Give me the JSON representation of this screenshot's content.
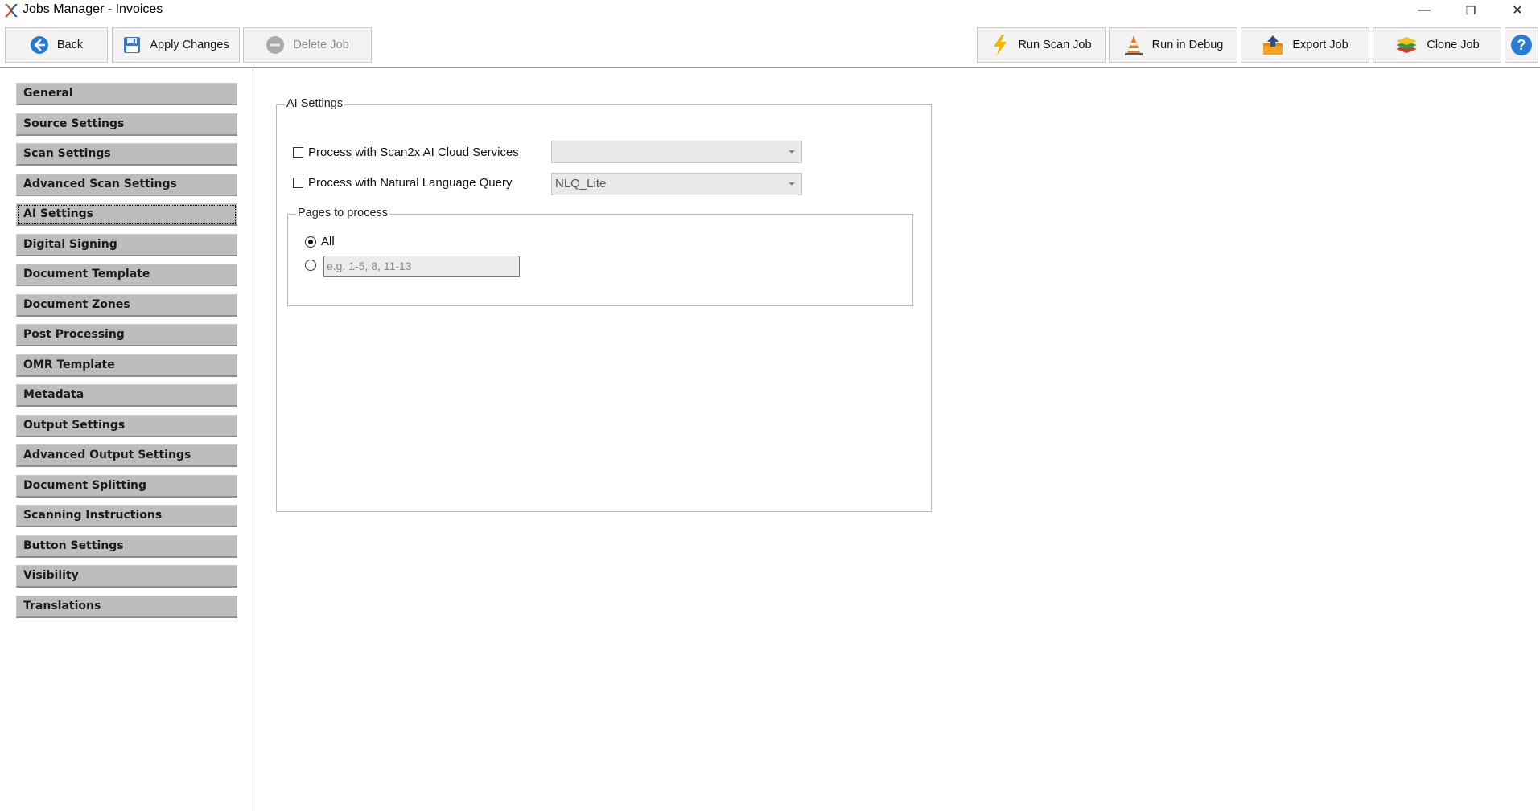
{
  "window": {
    "title": "Jobs Manager - Invoices",
    "controls": {
      "minimize": "—",
      "restore": "❐",
      "close": "✕"
    }
  },
  "toolbar": {
    "back_label": "Back",
    "apply_label": "Apply Changes",
    "delete_label": "Delete Job",
    "run_scan_label": "Run Scan Job",
    "run_debug_label": "Run in Debug",
    "export_label": "Export Job",
    "clone_label": "Clone Job",
    "help_symbol": "?"
  },
  "sidebar": {
    "items": [
      {
        "label": "General"
      },
      {
        "label": "Source Settings"
      },
      {
        "label": "Scan Settings"
      },
      {
        "label": "Advanced Scan Settings"
      },
      {
        "label": "AI Settings",
        "active": true
      },
      {
        "label": "Digital Signing"
      },
      {
        "label": "Document Template"
      },
      {
        "label": "Document Zones"
      },
      {
        "label": "Post Processing"
      },
      {
        "label": "OMR Template"
      },
      {
        "label": "Metadata"
      },
      {
        "label": "Output Settings"
      },
      {
        "label": "Advanced Output Settings"
      },
      {
        "label": "Document Splitting"
      },
      {
        "label": "Scanning Instructions"
      },
      {
        "label": "Button Settings"
      },
      {
        "label": "Visibility"
      },
      {
        "label": "Translations"
      }
    ]
  },
  "ai_settings": {
    "group_title": "AI Settings",
    "cloud_services": {
      "label": "Process with Scan2x AI Cloud Services",
      "checked": false,
      "value": ""
    },
    "nlq": {
      "label": "Process with Natural Language Query",
      "checked": false,
      "value": "NLQ_Lite"
    },
    "pages": {
      "group_title": "Pages to process",
      "all_label": "All",
      "all_selected": true,
      "range_placeholder": "e.g. 1-5, 8, 11-13"
    }
  },
  "colors": {
    "accent_blue": "#2b7bd3",
    "nav_bg": "#bdbdbd",
    "toolbar_border": "#9a9a9a"
  }
}
